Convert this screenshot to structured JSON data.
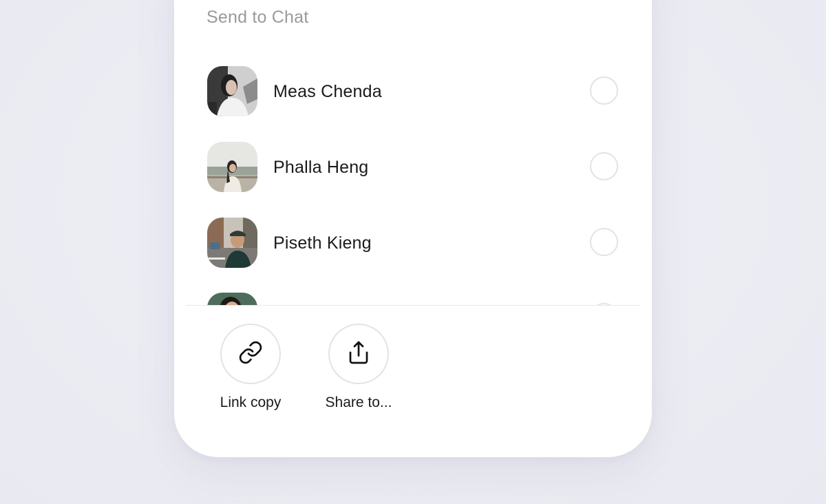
{
  "sheet": {
    "title": "Send to Chat"
  },
  "contacts": [
    {
      "name": "Meas Chenda",
      "selected": false,
      "avatar_icon": "avatar-photo-woman-1"
    },
    {
      "name": "Phalla Heng",
      "selected": false,
      "avatar_icon": "avatar-photo-woman-2"
    },
    {
      "name": "Piseth Kieng",
      "selected": false,
      "avatar_icon": "avatar-photo-man-1"
    },
    {
      "name": "",
      "selected": false,
      "avatar_icon": "avatar-photo-woman-3"
    }
  ],
  "actions": [
    {
      "label": "Link copy",
      "icon": "link-icon"
    },
    {
      "label": "Share to...",
      "icon": "share-icon"
    }
  ],
  "colors": {
    "background": "#ebebf3",
    "sheet": "#ffffff",
    "title_text": "#9a9a9a",
    "primary_text": "#1a1a1a",
    "outline": "#e3e3e3"
  }
}
